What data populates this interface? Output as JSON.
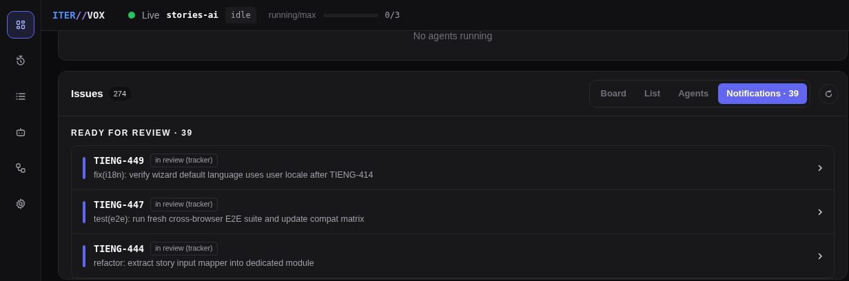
{
  "sidebar": {
    "items": [
      {
        "kind": "dashboard",
        "selected": true
      },
      {
        "kind": "history",
        "selected": false
      },
      {
        "kind": "list",
        "selected": false
      },
      {
        "kind": "robot",
        "selected": false
      },
      {
        "kind": "workflow",
        "selected": false
      },
      {
        "kind": "settings",
        "selected": false
      }
    ]
  },
  "header": {
    "logo": [
      {
        "text": "ITER",
        "color": "#4f8ff7"
      },
      {
        "text": "//",
        "color": "#a78bfa"
      },
      {
        "text": "VOX",
        "color": "#e5e7eb"
      }
    ],
    "status": {
      "label": "Live",
      "on": true
    },
    "project": "stories-ai",
    "state": "idle",
    "capacity_label": "running/max",
    "capacity_reading": "0/3"
  },
  "agents_panel": {
    "empty_text": "No agents running"
  },
  "issues": {
    "title": "Issues",
    "count": "274",
    "tabs": [
      {
        "label": "Board",
        "selected": false
      },
      {
        "label": "List",
        "selected": false
      },
      {
        "label": "Agents",
        "selected": false
      },
      {
        "label": "Notifications · 39",
        "selected": true
      }
    ],
    "section_title": "READY FOR REVIEW · 39",
    "rows": [
      {
        "id": "TIENG-449",
        "tag": "in review (tracker)",
        "title": "fix(i18n): verify wizard default language uses user locale after TIENG-414",
        "color": "#6366f1"
      },
      {
        "id": "TIENG-447",
        "tag": "in review (tracker)",
        "title": "test(e2e): run fresh cross-browser E2E suite and update compat matrix",
        "color": "#6366f1"
      },
      {
        "id": "TIENG-444",
        "tag": "in review (tracker)",
        "title": "refactor: extract story input mapper into dedicated module",
        "color": "#6366f1"
      }
    ]
  }
}
